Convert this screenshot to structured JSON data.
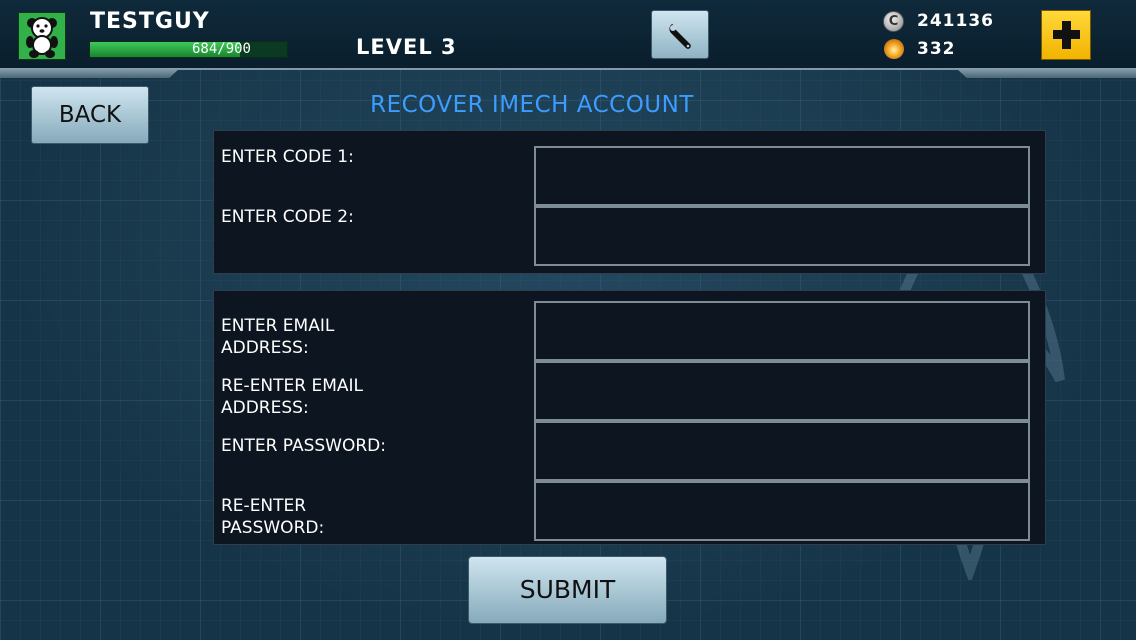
{
  "header": {
    "player_name": "TESTGUY",
    "xp_text": "684/900",
    "xp_progress": 0.76,
    "level_label": "LEVEL 3",
    "coins": "241136",
    "gems": "332",
    "coin_symbol": "C"
  },
  "nav": {
    "back_label": "BACK"
  },
  "page": {
    "title": "RECOVER IMECH ACCOUNT"
  },
  "code_section": {
    "fields": [
      {
        "label": "ENTER CODE 1:",
        "value": ""
      },
      {
        "label": "ENTER CODE 2:",
        "value": ""
      }
    ]
  },
  "account_section": {
    "fields": [
      {
        "label": "ENTER EMAIL\nADDRESS:",
        "value": ""
      },
      {
        "label": "RE-ENTER EMAIL\nADDRESS:",
        "value": ""
      },
      {
        "label": "ENTER PASSWORD:",
        "value": ""
      },
      {
        "label": "RE-ENTER\nPASSWORD:",
        "value": ""
      }
    ]
  },
  "actions": {
    "submit_label": "SUBMIT"
  },
  "colors": {
    "title_blue": "#3d9cff",
    "xp_green": "#2fae48",
    "add_yellow": "#f8c800"
  },
  "icons": {
    "avatar": "teddy-bear-icon",
    "settings": "wrench-icon",
    "coin": "coin-icon",
    "gem": "gem-icon",
    "add": "plus-icon"
  }
}
